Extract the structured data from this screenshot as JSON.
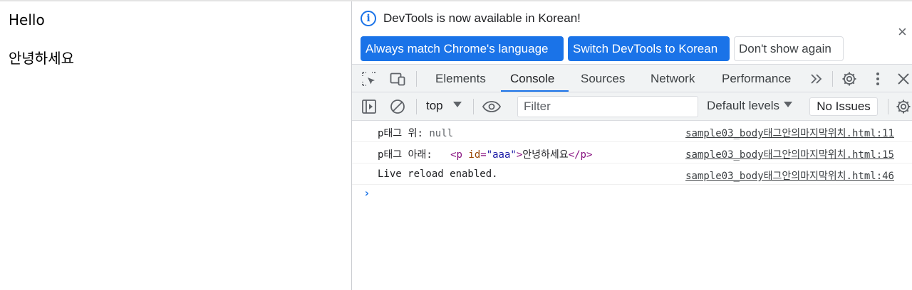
{
  "page": {
    "paragraph1": "Hello",
    "paragraph2": "안녕하세요"
  },
  "infobar": {
    "message": "DevTools is now available in Korean!",
    "btn_match": "Always match Chrome's language",
    "btn_switch": "Switch DevTools to Korean",
    "btn_dont_show": "Don't show again",
    "close": "×"
  },
  "tabs": [
    "Elements",
    "Console",
    "Sources",
    "Network",
    "Performance"
  ],
  "active_tab": "Console",
  "overflow": "»",
  "toolbar": {
    "context": "top",
    "filter_placeholder": "Filter",
    "levels": "Default levels",
    "issues": "No Issues"
  },
  "console": {
    "rows": [
      {
        "label": "p태그 위: ",
        "value": "null",
        "source": "sample03_body태그안의마지막위치.html:11"
      },
      {
        "label": "p태그 아래: ",
        "tag_open": "<p",
        "attr_name": " id",
        "attr_eq": "=",
        "attr_value": "\"aaa\"",
        "tag_close": ">",
        "text": "안녕하세요",
        "end_tag": "</p>",
        "source": "sample03_body태그안의마지막위치.html:15"
      },
      {
        "label": "Live reload enabled.",
        "source": "sample03_body태그안의마지막위치.html:46"
      }
    ],
    "prompt": "›"
  },
  "colors": {
    "accent": "#1a73e8",
    "toolbar_bg": "#f1f3f4",
    "html_tag": "#881280",
    "html_attr": "#994500",
    "html_attr_value": "#1a1aa6"
  },
  "icons": [
    "info-icon",
    "close-icon",
    "inspect-element-icon",
    "device-toolbar-icon",
    "overflow-chevron-icon",
    "settings-gear-icon",
    "more-vertical-icon",
    "sidebar-toggle-icon",
    "clear-console-icon",
    "eye-icon",
    "chevron-down-icon",
    "prompt-chevron-icon"
  ]
}
